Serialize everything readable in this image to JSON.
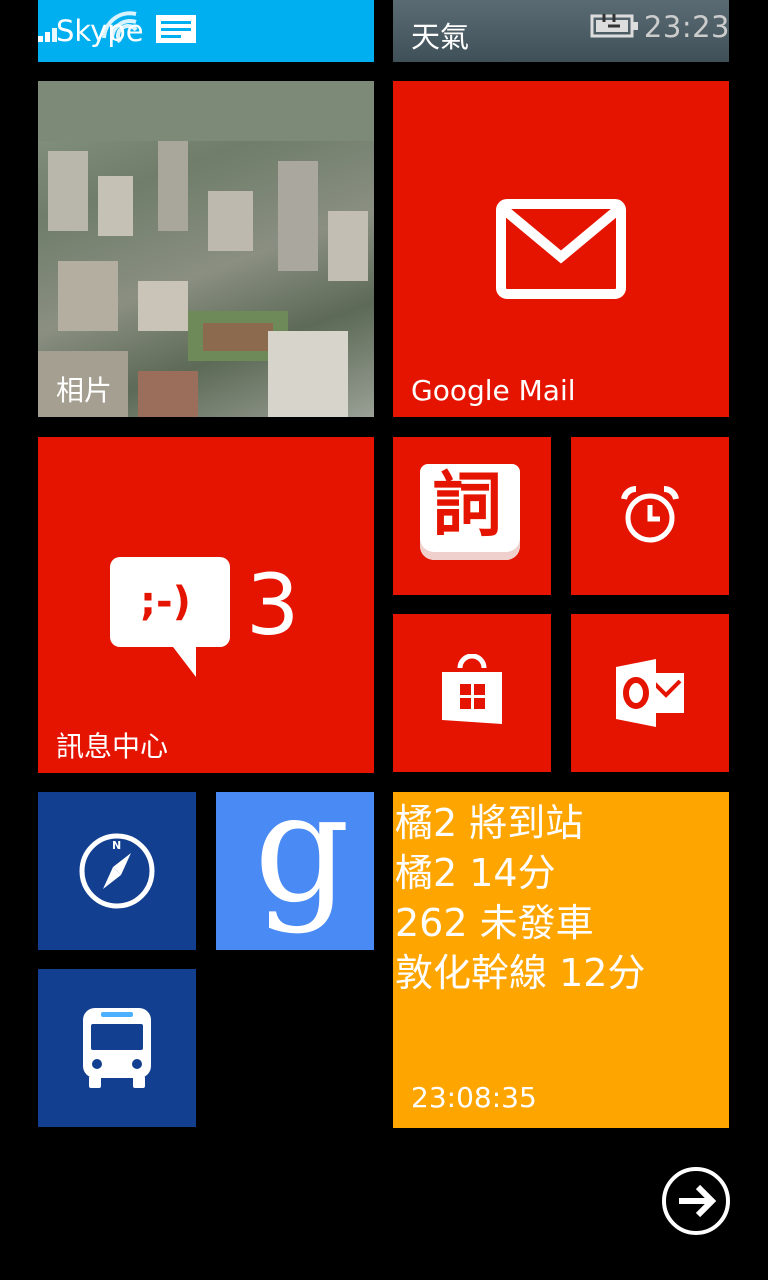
{
  "status_bar": {
    "time": "23:23"
  },
  "tiles": {
    "skype": {
      "label": "Skype",
      "color": "#00aff0"
    },
    "weather": {
      "label": "天氣"
    },
    "photos": {
      "label": "相片"
    },
    "gmail": {
      "label": "Google Mail",
      "color": "#e51400"
    },
    "messaging": {
      "label": "訊息中心",
      "count": "3",
      "emoticon": ";-)",
      "color": "#e51400"
    },
    "dictionary": {
      "glyph": "詞",
      "icon": "dictionary-icon",
      "color": "#e51400"
    },
    "alarms": {
      "icon": "alarm-clock-icon",
      "color": "#e51400"
    },
    "store": {
      "icon": "store-bag-icon",
      "color": "#e51400"
    },
    "outlook": {
      "icon": "outlook-icon",
      "color": "#e51400"
    },
    "compass": {
      "icon": "compass-icon",
      "letter": "N",
      "color": "#123f8f"
    },
    "google": {
      "icon": "google-g-icon",
      "letter": "g",
      "color": "#4a8af4"
    },
    "bus_arrival": {
      "color": "#ffa500",
      "lines": [
        "橘2 將到站",
        "橘2 14分",
        "262 未發車",
        "敦化幹線 12分"
      ],
      "updated": "23:08:35"
    },
    "bus_app": {
      "icon": "bus-icon",
      "color": "#123f8f"
    }
  },
  "navigation": {
    "next_icon": "arrow-right-circle-icon"
  }
}
